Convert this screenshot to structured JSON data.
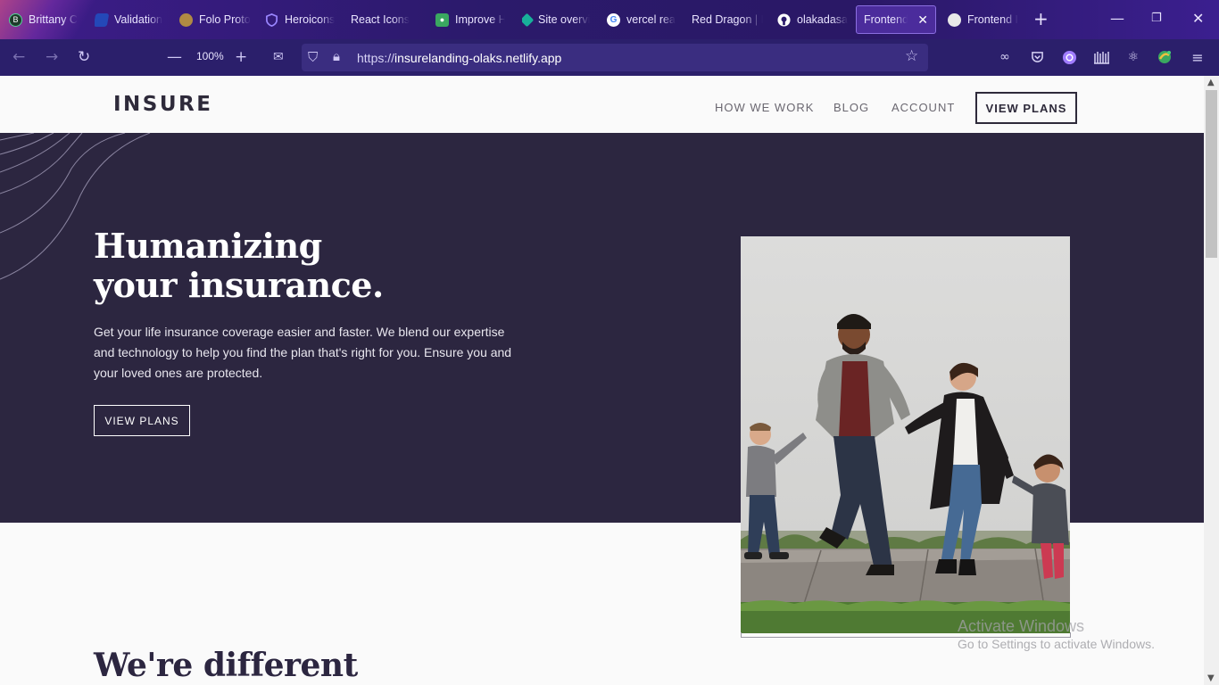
{
  "browser": {
    "tabs": [
      {
        "title": "Brittany C",
        "favicon": "B",
        "color": "#1d3b2a"
      },
      {
        "title": "Validation",
        "favicon": "",
        "color": "#2448b8"
      },
      {
        "title": "Folo Proto",
        "favicon": "",
        "color": "#9b7a3c"
      },
      {
        "title": "Heroicons",
        "favicon": "",
        "color": "#6d4bd6"
      },
      {
        "title": "React Icons",
        "favicon": "",
        "color": "#00000000"
      },
      {
        "title": "Improve H",
        "favicon": "",
        "color": "#3aa860"
      },
      {
        "title": "Site overvi",
        "favicon": "",
        "color": "#18b09a"
      },
      {
        "title": "vercel rea",
        "favicon": "G",
        "color": "#ffffff"
      },
      {
        "title": "Red Dragon | I",
        "favicon": "",
        "color": "#00000000"
      },
      {
        "title": "olakadasa",
        "favicon": "",
        "color": "#ffffff"
      },
      {
        "title": "Frontend M",
        "favicon": "",
        "color": "#00000000"
      },
      {
        "title": "Frontend I",
        "favicon": "",
        "color": "#e8e8e8"
      }
    ],
    "zoom": "100%",
    "url_prefix": "https://",
    "url_host": "insurelanding-olaks.netlify.app"
  },
  "site": {
    "logo": "INSURE",
    "nav": [
      "HOW WE WORK",
      "BLOG",
      "ACCOUNT"
    ],
    "cta": "VIEW PLANS"
  },
  "hero": {
    "title": "Humanizing your insurance.",
    "text": "Get your life insurance coverage easier and faster. We blend our expertise and technology to help you find the plan that's right for you. Ensure you and your loved ones are protected.",
    "button": "VIEW PLANS"
  },
  "section": {
    "title": "We're different"
  },
  "watermark": {
    "line1": "Activate Windows",
    "line2": "Go to Settings to activate Windows."
  },
  "colors": {
    "hero_bg": "#2c2640",
    "accent": "#4b2c9c"
  }
}
